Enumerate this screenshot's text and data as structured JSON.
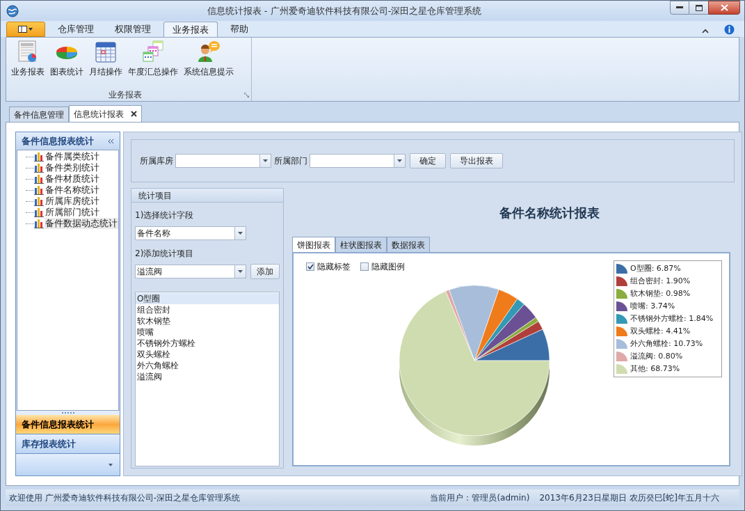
{
  "window": {
    "title": "信息统计报表 - 广州爱奇迪软件科技有限公司-深田之星仓库管理系统"
  },
  "ribbon": {
    "tabs": [
      {
        "label": "仓库管理",
        "selected": false
      },
      {
        "label": "权限管理",
        "selected": false
      },
      {
        "label": "业务报表",
        "selected": true
      },
      {
        "label": "帮助",
        "selected": false
      }
    ],
    "groups": [
      {
        "label": "业务报表",
        "buttons": [
          {
            "label": "业务报表",
            "kind": "sheet"
          },
          {
            "label": "图表统计",
            "kind": "pie"
          },
          {
            "label": "月结操作",
            "kind": "calendar"
          },
          {
            "label": "年度汇总操作",
            "kind": "calendars"
          },
          {
            "label": "系统信息提示",
            "kind": "user"
          }
        ]
      }
    ]
  },
  "doc_tabs": [
    {
      "label": "备件信息管理",
      "selected": false
    },
    {
      "label": "信息统计报表",
      "selected": true
    }
  ],
  "left_panel": {
    "title": "备件信息报表统计",
    "tree": [
      {
        "label": "备件属类统计",
        "selected": false
      },
      {
        "label": "备件类别统计",
        "selected": false
      },
      {
        "label": "备件材质统计",
        "selected": false
      },
      {
        "label": "备件名称统计",
        "selected": false
      },
      {
        "label": "所属库房统计",
        "selected": false
      },
      {
        "label": "所属部门统计",
        "selected": false
      },
      {
        "label": "备件数据动态统计",
        "selected": true
      }
    ],
    "nav": [
      {
        "label": "备件信息报表统计",
        "selected": true
      },
      {
        "label": "库存报表统计",
        "selected": false
      }
    ]
  },
  "filters": {
    "fields": [
      {
        "label": "所属库房"
      },
      {
        "label": "所属部门"
      }
    ],
    "buttons": [
      "确定",
      "导出报表"
    ]
  },
  "stats_panel": {
    "title": "统计项目",
    "step1": "1)选择统计字段",
    "field_value": "备件名称",
    "step2": "2)添加统计项目",
    "item_value": "溢流阀",
    "add_button": "添加",
    "items": [
      {
        "label": "O型圈",
        "selected": true
      },
      {
        "label": "组合密封",
        "selected": false
      },
      {
        "label": "软木钢垫",
        "selected": false
      },
      {
        "label": "喷嘴",
        "selected": false
      },
      {
        "label": "不锈钢外方螺栓",
        "selected": false
      },
      {
        "label": "双头螺栓",
        "selected": false
      },
      {
        "label": "外六角螺栓",
        "selected": false
      },
      {
        "label": "溢流阀",
        "selected": false
      }
    ]
  },
  "report": {
    "title": "备件名称统计报表",
    "tabs": [
      {
        "label": "饼图报表",
        "selected": true
      },
      {
        "label": "柱状图报表",
        "selected": false
      },
      {
        "label": "数据报表",
        "selected": false
      }
    ],
    "options": [
      {
        "label": "隐藏标签",
        "checked": true
      },
      {
        "label": "隐藏图例",
        "checked": false
      }
    ],
    "legend": [
      {
        "color": "#3b6ea6"
      },
      {
        "color": "#b03f3c"
      },
      {
        "color": "#8bac3e"
      },
      {
        "color": "#6b5193"
      },
      {
        "color": "#3399b4"
      },
      {
        "color": "#ef7b1a"
      },
      {
        "color": "#a7bdda"
      },
      {
        "color": "#dea9a7"
      },
      {
        "color": "#cfdcaf"
      }
    ],
    "chart_data": {
      "type": "pie",
      "categories": [
        "O型圈: 6.87%",
        "组合密封: 1.90%",
        "软木钢垫: 0.98%",
        "喷嘴: 3.74%",
        "不锈钢外方螺栓: 1.84%",
        "双头螺栓: 4.41%",
        "外六角螺栓: 10.73%",
        "溢流阀: 0.80%",
        "其他: 68.73%"
      ],
      "values": [
        6.87,
        1.9,
        0.98,
        3.74,
        1.84,
        4.41,
        10.73,
        0.8,
        68.73
      ]
    }
  },
  "status_bar": {
    "welcome": "欢迎使用 广州爱奇迪软件科技有限公司-深田之星仓库管理系统",
    "user": "当前用户：管理员(admin)",
    "date": "2013年6月23日星期日 农历癸巳[蛇]年五月十六"
  }
}
